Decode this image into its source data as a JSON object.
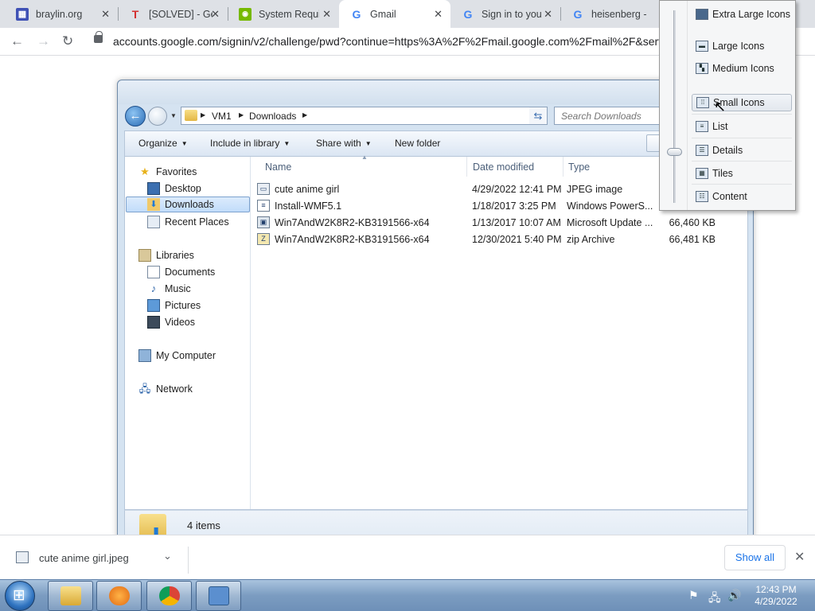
{
  "browser": {
    "tabs": [
      {
        "title": "braylin.org",
        "icon": "calendar-icon",
        "color": "#3f51b5"
      },
      {
        "title": "[SOLVED] - Ge",
        "icon": "t-logo-icon",
        "color": "#d32f2f"
      },
      {
        "title": "System Requi",
        "icon": "nvidia-icon",
        "color": "#76b900"
      },
      {
        "title": "Gmail",
        "icon": "google-icon",
        "color": "#4285f4"
      },
      {
        "title": "Sign in to you",
        "icon": "google-icon",
        "color": "#4285f4"
      },
      {
        "title": "heisenberg -",
        "icon": "google-icon",
        "color": "#4285f4"
      }
    ],
    "url": "accounts.google.com/signin/v2/challenge/pwd?continue=https%3A%2F%2Fmail.google.com%2Fmail%2F&service"
  },
  "explorer": {
    "breadcrumb": [
      "VM1",
      "Downloads"
    ],
    "search_placeholder": "Search Downloads",
    "commands": [
      "Organize",
      "Include in library",
      "Share with",
      "New folder"
    ],
    "nav": {
      "favorites": {
        "label": "Favorites",
        "items": [
          "Desktop",
          "Downloads",
          "Recent Places"
        ]
      },
      "libraries": {
        "label": "Libraries",
        "items": [
          "Documents",
          "Music",
          "Pictures",
          "Videos"
        ]
      },
      "computer": "My Computer",
      "network": "Network"
    },
    "columns": [
      "Name",
      "Date modified",
      "Type"
    ],
    "files": [
      {
        "name": "cute anime girl",
        "date": "4/29/2022 12:41 PM",
        "type": "JPEG image",
        "size": ""
      },
      {
        "name": "Install-WMF5.1",
        "date": "1/18/2017 3:25 PM",
        "type": "Windows PowerS...",
        "size": ""
      },
      {
        "name": "Win7AndW2K8R2-KB3191566-x64",
        "date": "1/13/2017 10:07 AM",
        "type": "Microsoft Update ...",
        "size": "66,460 KB"
      },
      {
        "name": "Win7AndW2K8R2-KB3191566-x64",
        "date": "12/30/2021 5:40 PM",
        "type": "zip Archive",
        "size": "66,481 KB"
      }
    ],
    "item_count": "4 items"
  },
  "view_menu": {
    "items": [
      "Extra Large Icons",
      "Large Icons",
      "Medium Icons",
      "Small Icons",
      "List",
      "Details",
      "Tiles",
      "Content"
    ],
    "hovered": "Small Icons"
  },
  "downloads_bar": {
    "file": "cute anime girl.jpeg",
    "show_all": "Show all"
  },
  "taskbar": {
    "time": "12:43 PM",
    "date": "4/29/2022"
  }
}
